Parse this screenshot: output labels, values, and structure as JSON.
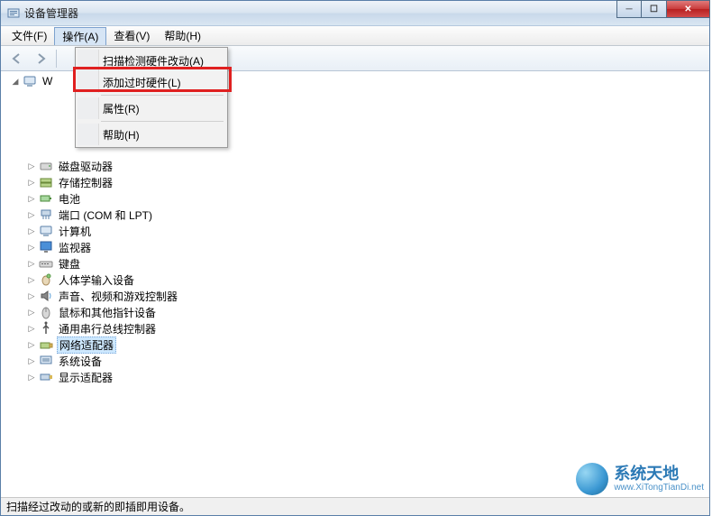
{
  "window": {
    "title": "设备管理器"
  },
  "menubar": {
    "file": "文件(F)",
    "action": "操作(A)",
    "view": "查看(V)",
    "help": "帮助(H)"
  },
  "action_menu": {
    "scan": "扫描检测硬件改动(A)",
    "add_legacy": "添加过时硬件(L)",
    "properties": "属性(R)",
    "help": "帮助(H)"
  },
  "tree": {
    "root_visible_prefix": "W",
    "items": [
      {
        "label": "磁盘驱动器",
        "icon": "disk-drive-icon"
      },
      {
        "label": "存储控制器",
        "icon": "storage-controller-icon"
      },
      {
        "label": "电池",
        "icon": "battery-icon"
      },
      {
        "label": "端口 (COM 和 LPT)",
        "icon": "port-icon"
      },
      {
        "label": "计算机",
        "icon": "computer-icon"
      },
      {
        "label": "监视器",
        "icon": "monitor-icon"
      },
      {
        "label": "键盘",
        "icon": "keyboard-icon"
      },
      {
        "label": "人体学输入设备",
        "icon": "hid-icon"
      },
      {
        "label": "声音、视频和游戏控制器",
        "icon": "sound-icon"
      },
      {
        "label": "鼠标和其他指针设备",
        "icon": "mouse-icon"
      },
      {
        "label": "通用串行总线控制器",
        "icon": "usb-icon"
      },
      {
        "label": "网络适配器",
        "icon": "network-adapter-icon",
        "selected": true
      },
      {
        "label": "系统设备",
        "icon": "system-device-icon"
      },
      {
        "label": "显示适配器",
        "icon": "display-adapter-icon"
      }
    ]
  },
  "statusbar": {
    "text": "扫描经过改动的或新的即插即用设备。"
  },
  "watermark": {
    "title": "系统天地",
    "url": "www.XiTongTianDi.net"
  }
}
